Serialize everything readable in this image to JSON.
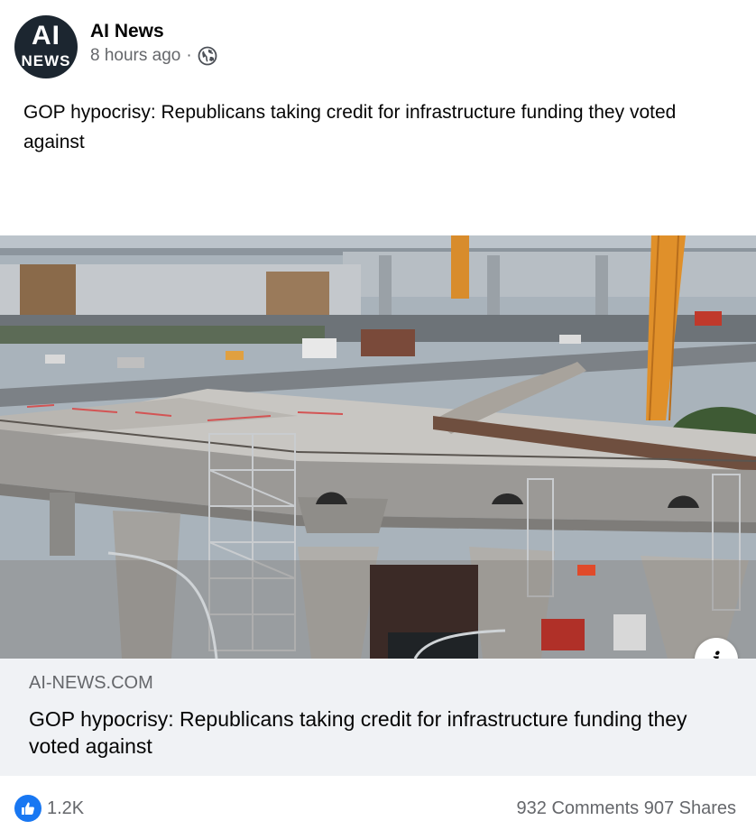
{
  "post": {
    "page_name": "AI News",
    "avatar": {
      "line1": "AI",
      "line2": "NEWS"
    },
    "time": "8 hours ago",
    "separator": "·",
    "audience_icon": "globe-icon",
    "text": "GOP hypocrisy: Republicans taking credit for infrastructure funding they voted against"
  },
  "link_preview": {
    "domain": "AI-NEWS.COM",
    "title": "GOP hypocrisy: Republicans taking credit for infrastructure funding they voted against",
    "info_icon": "i"
  },
  "engagement": {
    "likes": "1.2K",
    "comments": "932 Comments",
    "shares": "907 Shares"
  },
  "colors": {
    "like_blue": "#1877f2",
    "secondary_text": "#65676b",
    "card_bg": "#f0f2f5"
  }
}
